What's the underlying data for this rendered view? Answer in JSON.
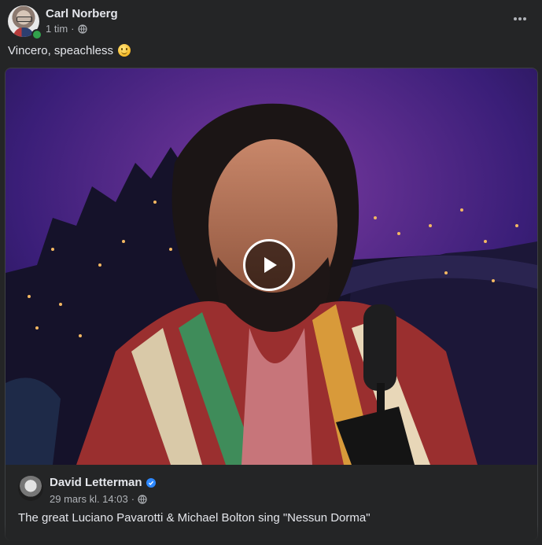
{
  "post": {
    "author": "Carl Norberg",
    "time": "1 tim",
    "separator": "·",
    "privacy_icon": "globe-icon",
    "text": "Vincero, speachless",
    "emoji": "slightly-smiling-face"
  },
  "shared_post": {
    "author": "David Letterman",
    "verified_icon": "verified-badge-icon",
    "date": "29 mars kl. 14:03",
    "separator": "·",
    "privacy_icon": "globe-icon",
    "text": "The great Luciano Pavarotti & Michael Bolton sing \"Nessun Dorma\""
  },
  "video": {
    "play_icon": "play-icon"
  },
  "colors": {
    "background": "#242526",
    "text_primary": "#e4e6eb",
    "text_secondary": "#b0b3b8",
    "verified": "#2d88ff",
    "online": "#31a24c"
  }
}
